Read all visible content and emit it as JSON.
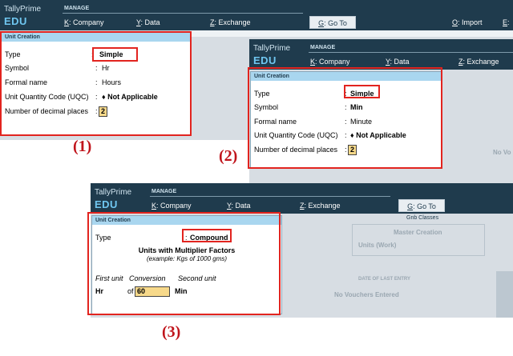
{
  "brand": {
    "line1": "TallyPrime",
    "line2": "EDU"
  },
  "menu": {
    "section": "MANAGE",
    "company_key": "K",
    "company_label": ": Company",
    "data_key": "Y",
    "data_label": ": Data",
    "exchange_key": "Z",
    "exchange_label": ": Exchange",
    "goto_key": "G",
    "goto_label": ": Go To",
    "import_key": "O",
    "import_label": ": Import",
    "e_key": "E",
    "e_label": ": "
  },
  "subheader": {
    "gnb": "Gnb Classes"
  },
  "panel_title": "Unit Creation",
  "captions": {
    "one": "(1)",
    "two": "(2)",
    "three": "(3)"
  },
  "screen1": {
    "type_label": "Type",
    "type_value": "Simple",
    "symbol_label": "Symbol",
    "symbol_value": "Hr",
    "formal_label": "Formal name",
    "formal_value": "Hours",
    "uqc_label": "Unit Quantity Code (UQC)",
    "uqc_value": "Not Applicable",
    "decimal_label": "Number of decimal places",
    "decimal_value": "2"
  },
  "screen2": {
    "type_label": "Type",
    "type_value": "Simple",
    "symbol_label": "Symbol",
    "symbol_value": "Min",
    "formal_label": "Formal name",
    "formal_value": "Minute",
    "uqc_label": "Unit Quantity Code (UQC)",
    "uqc_value": "Not Applicable",
    "decimal_label": "Number of decimal places",
    "decimal_value": "2",
    "bg_no_vouchers": "No Vo"
  },
  "screen3": {
    "type_label": "Type",
    "type_value": "Compound",
    "heading": "Units with Multiplier Factors",
    "example": "(example: Kgs of 1000 gms)",
    "first_unit_label": "First unit",
    "conversion_label": "Conversion",
    "second_unit_label": "Second unit",
    "first_unit": "Hr",
    "of_label": "of",
    "conversion_value": "60",
    "second_unit": "Min",
    "bg_master_creation": "Master Creation",
    "bg_units_work": "Units (Work)",
    "bg_date_last_entry": "DATE OF LAST ENTRY",
    "bg_no_vouchers": "No Vouchers Entered"
  },
  "colon": ":",
  "uqc_marker": "♦"
}
